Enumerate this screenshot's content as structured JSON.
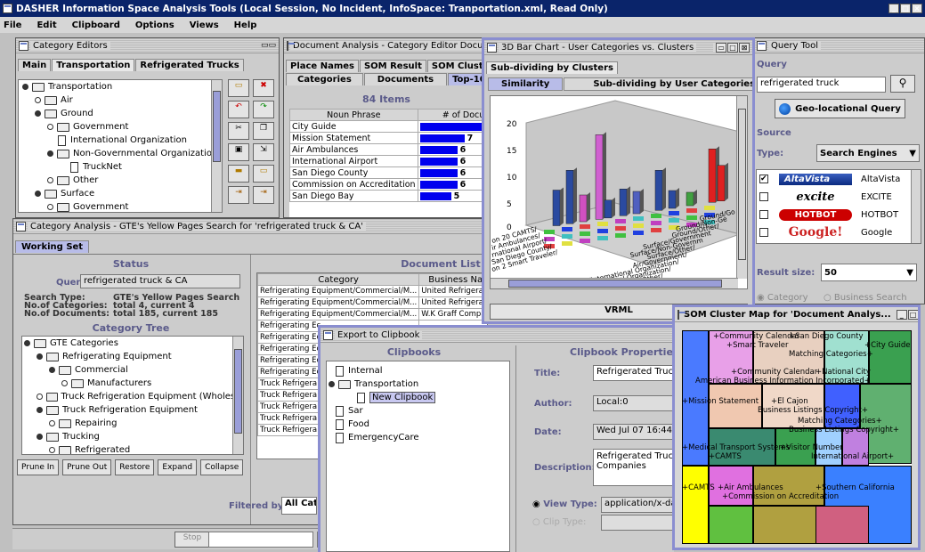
{
  "app": {
    "title": "DASHER Information Space Analysis Tools (Local Session, No Incident, InfoSpace: Tranportation.xml, Read Only)"
  },
  "menu": [
    "File",
    "Edit",
    "Clipboard",
    "Options",
    "Views",
    "Help"
  ],
  "category_editors": {
    "title": "Category Editors",
    "tabs": [
      "Main",
      "Transportation",
      "Refrigerated Trucks"
    ],
    "tree": [
      "Transportation",
      "Air",
      "Ground",
      "Government",
      "International Organization",
      "Non-Governmental Organization",
      "TruckNet",
      "Other",
      "Surface",
      "Government"
    ]
  },
  "doc_analysis": {
    "title": "Document Analysis - Category Editor Docum",
    "tabs_row1": [
      "Place Names",
      "SOM Result",
      "SOM Clusters"
    ],
    "tabs_row2": [
      "Categories",
      "Documents",
      "Top-100"
    ],
    "count": "84 Items",
    "headers": [
      "Noun Phrase",
      "# of Docume"
    ],
    "rows": [
      {
        "phrase": "City Guide",
        "n": "",
        "bar": 1.0
      },
      {
        "phrase": "Mission Statement",
        "n": "7",
        "bar": 0.45
      },
      {
        "phrase": "Air Ambulances",
        "n": "6",
        "bar": 0.38
      },
      {
        "phrase": "International Airport",
        "n": "6",
        "bar": 0.38
      },
      {
        "phrase": "San Diego County",
        "n": "6",
        "bar": 0.38
      },
      {
        "phrase": "Commission on Accreditation",
        "n": "6",
        "bar": 0.38
      },
      {
        "phrase": "San Diego Bay",
        "n": "5",
        "bar": 0.32
      }
    ]
  },
  "bar3d": {
    "title": "3D Bar Chart - User Categories vs. Clusters",
    "tab": "Sub-dividing by Clusters",
    "subtabs": [
      "Similarity",
      "Sub-dividing by User Categories"
    ],
    "yticks": [
      "20",
      "15",
      "10",
      "5",
      "0"
    ],
    "right_labels": [
      "Ground/Go",
      "Ground/Non-Ge",
      "Ground/Other/",
      "Surface/Government",
      "Surface/Non-Governm",
      "Surface/Other/",
      "Air/Government/",
      "Air/International Organization/",
      "Air/Non-Governmental Organization/",
      "Air/Other/"
    ],
    "left_labels": [
      "on 20 CAMTS/",
      "ir Ambulances/",
      "rnational Airport/",
      "San Diego County/",
      "on 2 Smart Traveler/"
    ],
    "button": "VRML"
  },
  "query": {
    "title": "Query Tool",
    "query_label": "Query",
    "query_value": "refrigerated truck",
    "geo_button": "Geo-locational Query",
    "source_label": "Source",
    "type_label": "Type:",
    "type_value": "Search Engines",
    "engines": [
      {
        "name": "AltaVista",
        "logo": "AltaVista",
        "checked": true
      },
      {
        "name": "EXCITE",
        "logo": "excite",
        "checked": false
      },
      {
        "name": "HOTBOT",
        "logo": "HOTBOT",
        "checked": false
      },
      {
        "name": "Google",
        "logo": "Google!",
        "checked": false
      }
    ],
    "result_label": "Result size:",
    "result_value": "50",
    "radio1": "Category",
    "radio2": "Business Search"
  },
  "cat_analysis": {
    "title": "Category Analysis - GTE's Yellow Pages Search for 'refrigerated truck & CA'",
    "tab": "Working Set",
    "status_title": "Status",
    "query_label": "Query:",
    "query_value": "refrigerated truck & CA",
    "search_type_label": "Search Type:",
    "search_type_value": "GTE's Yellow Pages Search",
    "cats_label": "No.of Categories:",
    "cats_value": "total 4, current 4",
    "docs_label": "No.of Documents:",
    "docs_value": "total 185, current 185",
    "tree_title": "Category Tree",
    "tree": [
      "GTE Categories",
      "Refrigerating Equipment",
      "Commercial",
      "Manufacturers",
      "Truck Refrigeration Equipment (Wholesal",
      "Truck Refrigeration Equipment",
      "Repairing",
      "Trucking",
      "Refrigerated"
    ],
    "buttons": [
      "Prune In",
      "Prune Out",
      "Restore",
      "Expand",
      "Collapse"
    ],
    "doclist_title": "Document List",
    "doc_headers": [
      "Category",
      "Business Name"
    ],
    "doc_rows": [
      [
        "Refrigerating Equipment/Commercial/M...",
        "United Refrigeration"
      ],
      [
        "Refrigerating Equipment/Commercial/M...",
        "United Refrigeration I"
      ],
      [
        "Refrigerating Equipment/Commercial/M...",
        "W.K Graff Company"
      ],
      [
        "Refrigerating Ec",
        ""
      ],
      [
        "Refrigerating Ec",
        ""
      ],
      [
        "Refrigerating Ec",
        ""
      ],
      [
        "Refrigerating Ec",
        ""
      ],
      [
        "Refrigerating Ec",
        ""
      ],
      [
        "Truck Refrigera",
        ""
      ],
      [
        "Truck Refrigera",
        ""
      ],
      [
        "Truck Refrigera",
        ""
      ],
      [
        "Truck Refrigera",
        ""
      ],
      [
        "Truck Refrigera",
        ""
      ]
    ],
    "filtered_label": "Filtered by:",
    "filtered_value": "All Cate"
  },
  "export": {
    "title": "Export to Clipbook",
    "clipbooks_title": "Clipbooks",
    "clipbooks": [
      "Internal",
      "Transportation",
      "New Clipbook",
      "Sar",
      "Food",
      "EmergencyCare"
    ],
    "props_title": "Clipbook Properties",
    "title_label": "Title:",
    "title_value": "Refrigerated Truck",
    "author_label": "Author:",
    "author_value": "Local:0",
    "date_label": "Date:",
    "date_value": "Wed Jul 07 16:44:",
    "desc_label": "Description:",
    "desc_value1": "Refrigerated Truck",
    "desc_value2": "Companies",
    "viewtype_label": "View Type:",
    "viewtype_value": "application/x-das",
    "cliptype_label": "Clip Type:"
  },
  "som": {
    "title": "SOM Cluster Map for 'Document Analys...",
    "labels": [
      "+Community Calendar",
      "+San Diego County",
      "+Smart Traveler",
      "+City Guide",
      "Matching Categories+",
      "+Community Calendar",
      "+National City",
      "American Business Information Incorporated+",
      "+Mission Statement",
      "+El Cajon",
      "Business Listings Copyright+",
      "Matching Categories+",
      "Business Listings Copyright+",
      "+Medical Transport Systems",
      "+Visitor Number",
      "+CAMTS",
      "International Airport+",
      "+CAMTS",
      "+Air Ambulances",
      "+Southern California",
      "+Commission on Accreditation"
    ]
  },
  "statusbar": {
    "stop": "Stop",
    "nav": "<"
  }
}
